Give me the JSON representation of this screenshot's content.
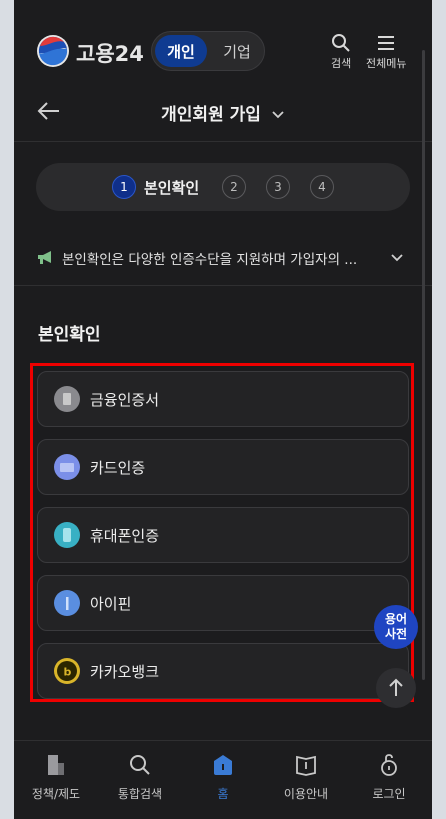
{
  "header": {
    "brand": "고용24",
    "toggle": [
      "개인",
      "기업"
    ],
    "search_label": "검색",
    "menu_label": "전체메뉴"
  },
  "subheader": {
    "title": "개인회원 가입"
  },
  "steps": {
    "numbers": [
      "1",
      "2",
      "3",
      "4"
    ],
    "active_label": "본인확인"
  },
  "notice": {
    "text": "본인확인은 다양한 인증수단을 지원하며 가입자의 ..."
  },
  "section": {
    "title": "본인확인"
  },
  "methods": [
    {
      "label": "금융인증서",
      "color": "#8a8a8e"
    },
    {
      "label": "카드인증",
      "color": "#7b8fe8"
    },
    {
      "label": "휴대폰인증",
      "color": "#38b0c4"
    },
    {
      "label": "아이핀",
      "color": "#5a8ee0"
    },
    {
      "label": "카카오뱅크",
      "color": "#d9b52a"
    }
  ],
  "fab": {
    "dictionary": "용어\n사전"
  },
  "bottom_nav": [
    {
      "label": "정책/제도"
    },
    {
      "label": "통합검색"
    },
    {
      "label": "홈"
    },
    {
      "label": "이용안내"
    },
    {
      "label": "로그인"
    }
  ],
  "colors": {
    "accent": "#0f3b91",
    "highlight_box": "#ee0000",
    "home_active": "#3a7bd5"
  }
}
